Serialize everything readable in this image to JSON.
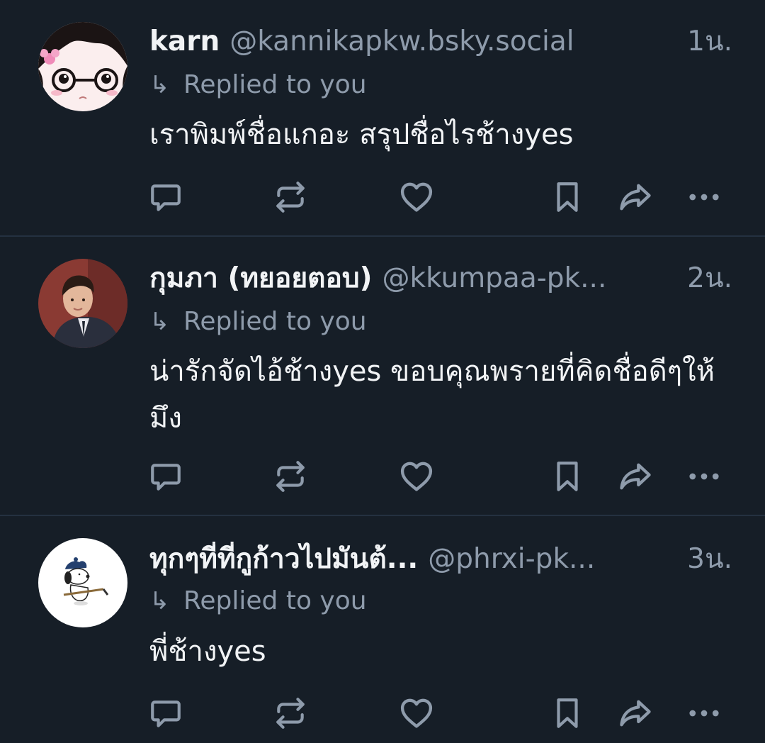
{
  "theme": {
    "background": "#161e27",
    "divider": "#243140",
    "text_primary": "#f1f3f5",
    "text_secondary": "#8e9bab",
    "icon_color": "#8e9bab"
  },
  "replied_label": "Replied to you",
  "reply_arrow_glyph": "↳",
  "posts": [
    {
      "display_name": "karn",
      "handle": "@kannikapkw.bsky.social",
      "time": "1น.",
      "text": "เราพิมพ์ชื่อแกอะ สรุปชื่อไรช้างyes",
      "avatar_icon": "anime-girl-glasses-avatar"
    },
    {
      "display_name": "กุมภา (ทยอยตอบ)",
      "handle": "@kkumpaa-pk...",
      "time": "2น.",
      "text": "น่ารักจัดไอ้ช้างyes ขอบคุณพรายที่คิดชื่อดีๆให้มึง",
      "avatar_icon": "man-in-suit-avatar"
    },
    {
      "display_name": "ทุกๆที่ที่กูก้าวไปมันต้...",
      "handle": "@phrxi-pk...",
      "time": "3น.",
      "text": "พี่ช้างyes",
      "avatar_icon": "snoopy-hockey-avatar"
    }
  ],
  "action_icons": [
    "reply-icon",
    "repost-icon",
    "like-icon",
    "bookmark-icon",
    "share-icon",
    "more-icon"
  ]
}
